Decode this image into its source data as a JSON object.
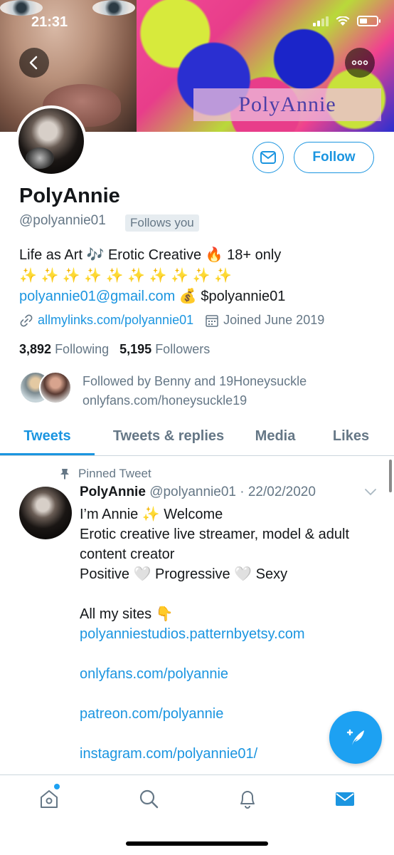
{
  "status": {
    "time": "21:31"
  },
  "banner": {
    "title": "PolyAnnie"
  },
  "profile": {
    "follow_label": "Follow",
    "name": "PolyAnnie",
    "handle": "@polyannie01",
    "follows_you": "Follows you",
    "bio_line1": "Life as Art 🎶 Erotic Creative 🔥 18+ only",
    "bio_line2": "✨ ✨ ✨ ✨ ✨ ✨ ✨ ✨ ✨ ✨",
    "bio_email": "polyannie01@gmail.com",
    "bio_money": "💰 $polyannie01",
    "website": "allmylinks.com/polyannie01",
    "joined": "Joined June 2019",
    "following_count": "3,892",
    "following_label": "Following",
    "followers_count": "5,195",
    "followers_label": "Followers",
    "followed_by_line1": "Followed by Benny and 19Honeysuckle",
    "followed_by_line2": "onlyfans.com/honeysuckle19"
  },
  "tabs": [
    {
      "label": "Tweets"
    },
    {
      "label": "Tweets & replies"
    },
    {
      "label": "Media"
    },
    {
      "label": "Likes"
    }
  ],
  "tweet": {
    "pinned_label": "Pinned Tweet",
    "author": "PolyAnnie",
    "meta": "@polyannie01 · 22/02/2020",
    "line1": "I’m Annie ✨ Welcome",
    "line2": "Erotic creative live streamer, model & adult content creator",
    "line3": "Positive 🤍 Progressive 🤍 Sexy",
    "line4": "All my sites 👇",
    "link1": "polyanniestudios.patternbyetsy.com",
    "link2": "onlyfans.com/polyannie",
    "link3": "patreon.com/polyannie",
    "link4": "instagram.com/polyannie01/"
  },
  "colors": {
    "accent": "#1b95e0",
    "muted": "#657786"
  }
}
